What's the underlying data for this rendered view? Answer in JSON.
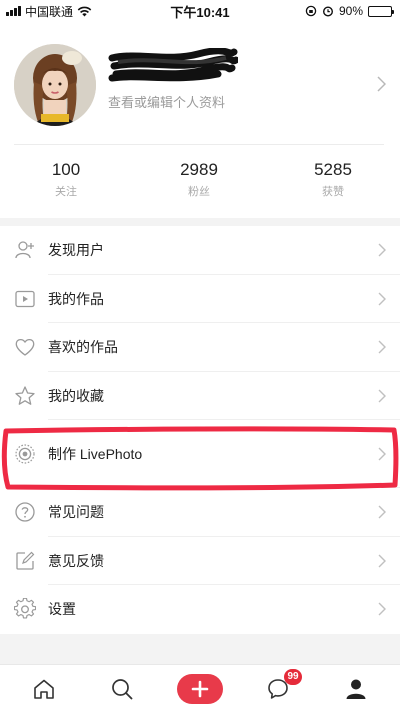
{
  "status_bar": {
    "carrier": "中国联通",
    "time": "下午10:41",
    "battery": "90%",
    "battery_level": 0.9
  },
  "profile": {
    "subtitle": "查看或编辑个人资料",
    "stats": [
      {
        "value": "100",
        "label": "关注"
      },
      {
        "value": "2989",
        "label": "粉丝"
      },
      {
        "value": "5285",
        "label": "获赞"
      }
    ]
  },
  "menu": {
    "items": [
      {
        "label": "发现用户",
        "icon": "add-user-icon"
      },
      {
        "label": "我的作品",
        "icon": "play-icon"
      },
      {
        "label": "喜欢的作品",
        "icon": "heart-icon"
      },
      {
        "label": "我的收藏",
        "icon": "star-icon"
      },
      {
        "label": "制作 LivePhoto",
        "icon": "livephoto-icon"
      },
      {
        "label": "常见问题",
        "icon": "question-icon"
      },
      {
        "label": "意见反馈",
        "icon": "edit-icon"
      },
      {
        "label": "设置",
        "icon": "gear-icon"
      }
    ]
  },
  "tabbar": {
    "tabs": [
      {
        "icon": "home-icon"
      },
      {
        "icon": "search-icon"
      },
      {
        "icon": "plus-icon"
      },
      {
        "icon": "message-icon",
        "badge": "99"
      },
      {
        "icon": "profile-icon"
      }
    ],
    "accent": "#e83a4a"
  }
}
